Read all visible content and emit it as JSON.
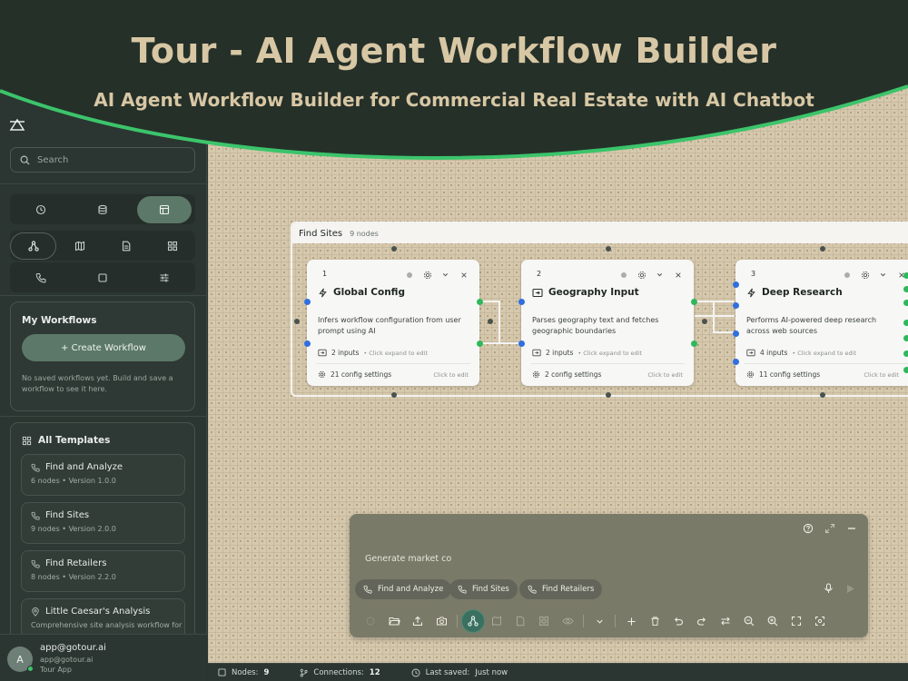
{
  "banner": {
    "title": "Tour - AI Agent Workflow Builder",
    "subtitle": "AI Agent Workflow Builder for Commercial Real Estate with AI Chatbot"
  },
  "sidebar": {
    "search_placeholder": "Search",
    "my_workflows": {
      "title": "My Workflows",
      "create_label": "+ Create Workflow",
      "empty_message": "No saved workflows yet. Build and save a workflow to see it here."
    },
    "templates": {
      "title": "All Templates",
      "items": [
        {
          "name": "Find and Analyze",
          "meta": "6 nodes • Version 1.0.0",
          "icon": "phone-icon"
        },
        {
          "name": "Find Sites",
          "meta": "9 nodes • Version 2.0.0",
          "icon": "phone-icon"
        },
        {
          "name": "Find Retailers",
          "meta": "8 nodes • Version 2.2.0",
          "icon": "phone-icon"
        },
        {
          "name": "Little Caesar's Analysis",
          "meta": "Comprehensive site analysis workflow for",
          "icon": "location-pin-icon"
        }
      ]
    },
    "user": {
      "initial": "A",
      "name": "app@gotour.ai",
      "email": "app@gotour.ai",
      "app": "Tour App"
    }
  },
  "canvas": {
    "group": {
      "name": "Find Sites",
      "count": "9 nodes"
    },
    "nodes": [
      {
        "num": "1",
        "title": "Global Config",
        "icon": "bolt-icon",
        "desc": "Infers workflow configuration from user prompt using AI",
        "inputs": "2 inputs",
        "hint": "• Click expand to edit",
        "config": "21 config settings",
        "edit": "Click to edit"
      },
      {
        "num": "2",
        "title": "Geography Input",
        "icon": "input-icon",
        "desc": "Parses geography text and fetches geographic boundaries",
        "inputs": "2 inputs",
        "hint": "• Click expand to edit",
        "config": "2 config settings",
        "edit": "Click to edit"
      },
      {
        "num": "3",
        "title": "Deep Research",
        "icon": "bolt-icon",
        "desc": "Performs AI-powered deep research across web sources",
        "inputs": "4 inputs",
        "hint": "• Click expand to edit",
        "config": "11 config settings",
        "edit": "Click to edit"
      }
    ]
  },
  "chat": {
    "input_value": "Generate market co",
    "chips": [
      "Find and Analyze",
      "Find Sites",
      "Find Retailers"
    ]
  },
  "status": {
    "nodes_label": "Nodes:",
    "nodes_value": "9",
    "connections_label": "Connections:",
    "connections_value": "12",
    "saved_label": "Last saved:",
    "saved_value": "Just now"
  },
  "colors": {
    "accent": "#5c7868",
    "port_in": "#2f6fe0",
    "port_out": "#2fb85a",
    "banner_text": "#d8c7a4",
    "banner_arc": "#3cc46b"
  }
}
